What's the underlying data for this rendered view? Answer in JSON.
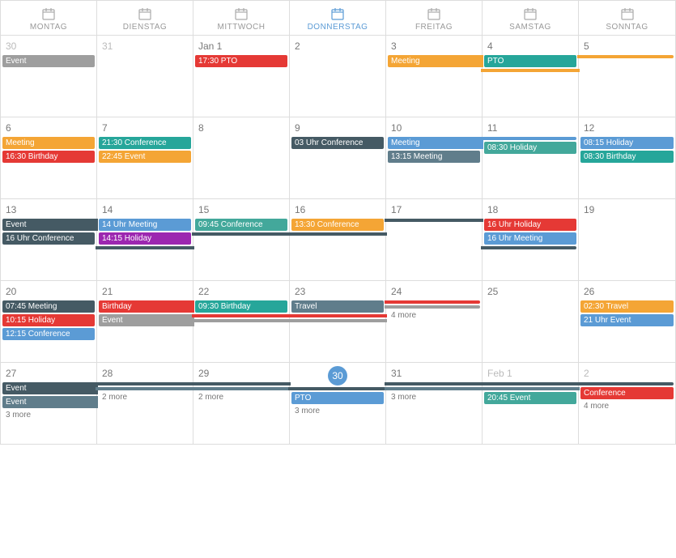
{
  "calendar": {
    "days": [
      "MONTAG",
      "DIENSTAG",
      "MITTWOCH",
      "DONNERSTAG",
      "FREITAG",
      "SAMSTAG",
      "SONNTAG"
    ],
    "today_col": 3,
    "weeks": [
      {
        "days": [
          {
            "num": "30",
            "other": true,
            "events": [
              {
                "label": "Event",
                "color": "c-gray",
                "time": "",
                "type": "normal"
              }
            ]
          },
          {
            "num": "31",
            "other": true,
            "events": []
          },
          {
            "num": "Jan 1",
            "other": false,
            "events": [
              {
                "label": "17:30 PTO",
                "color": "c-red",
                "time": "",
                "type": "normal"
              }
            ]
          },
          {
            "num": "2",
            "other": false,
            "events": []
          },
          {
            "num": "3",
            "other": false,
            "events": [
              {
                "label": "Meeting",
                "color": "c-orange",
                "time": "",
                "type": "span-start"
              }
            ]
          },
          {
            "num": "4",
            "other": false,
            "events": [
              {
                "label": "PTO",
                "color": "c-teal",
                "time": "",
                "type": "normal"
              },
              {
                "label": "",
                "color": "c-orange",
                "time": "",
                "type": "span-mid"
              }
            ]
          },
          {
            "num": "5",
            "other": false,
            "events": [
              {
                "label": "",
                "color": "c-orange",
                "time": "",
                "type": "span-end"
              }
            ]
          }
        ]
      },
      {
        "days": [
          {
            "num": "6",
            "other": false,
            "events": [
              {
                "label": "Meeting",
                "color": "c-orange",
                "time": "",
                "type": "normal"
              },
              {
                "label": "16:30 Birthday",
                "color": "c-red",
                "time": "",
                "type": "normal"
              }
            ]
          },
          {
            "num": "7",
            "other": false,
            "events": [
              {
                "label": "21:30 Conference",
                "color": "c-teal",
                "time": "",
                "type": "normal"
              },
              {
                "label": "22:45 Event",
                "color": "c-orange",
                "time": "",
                "type": "normal"
              }
            ]
          },
          {
            "num": "8",
            "other": false,
            "events": []
          },
          {
            "num": "9",
            "other": false,
            "events": [
              {
                "label": "03 Uhr Conference",
                "color": "c-darkblue",
                "time": "",
                "type": "normal"
              }
            ]
          },
          {
            "num": "10",
            "other": false,
            "events": [
              {
                "label": "Meeting",
                "color": "c-blue",
                "time": "",
                "type": "span-start"
              },
              {
                "label": "13:15 Meeting",
                "color": "c-darkgray",
                "time": "",
                "type": "normal"
              }
            ]
          },
          {
            "num": "11",
            "other": false,
            "events": [
              {
                "label": "08:30 Holiday",
                "color": "c-green",
                "time": "",
                "type": "normal"
              },
              {
                "label": "",
                "color": "c-blue",
                "time": "",
                "type": "span-end"
              }
            ]
          },
          {
            "num": "12",
            "other": false,
            "events": [
              {
                "label": "08:15 Holiday",
                "color": "c-blue",
                "time": "",
                "type": "normal"
              },
              {
                "label": "08:30 Birthday",
                "color": "c-teal",
                "time": "",
                "type": "normal"
              }
            ]
          }
        ]
      },
      {
        "days": [
          {
            "num": "13",
            "other": false,
            "events": [
              {
                "label": "Event",
                "color": "c-darkblue",
                "type": "span-start"
              },
              {
                "label": "16 Uhr Conference",
                "color": "c-darkblue",
                "time": "",
                "type": "normal"
              }
            ]
          },
          {
            "num": "14",
            "other": false,
            "events": [
              {
                "label": "14 Uhr Meeting",
                "color": "c-blue",
                "time": "",
                "type": "normal"
              },
              {
                "label": "14:15 Holiday",
                "color": "c-purple",
                "time": "",
                "type": "normal"
              },
              {
                "label": "",
                "color": "c-darkblue",
                "type": "span-mid"
              }
            ]
          },
          {
            "num": "15",
            "other": false,
            "events": [
              {
                "label": "09:45 Conference",
                "color": "c-green",
                "time": "",
                "type": "normal"
              },
              {
                "label": "",
                "color": "c-darkblue",
                "type": "span-mid"
              }
            ]
          },
          {
            "num": "16",
            "other": false,
            "events": [
              {
                "label": "13:30 Conference",
                "color": "c-orange",
                "time": "",
                "type": "normal"
              },
              {
                "label": "",
                "color": "c-darkblue",
                "type": "span-mid"
              }
            ]
          },
          {
            "num": "17",
            "other": false,
            "events": [
              {
                "label": "",
                "color": "c-darkblue",
                "type": "span-mid"
              }
            ]
          },
          {
            "num": "18",
            "other": false,
            "events": [
              {
                "label": "16 Uhr Holiday",
                "color": "c-red",
                "time": "",
                "type": "normal"
              },
              {
                "label": "16 Uhr Meeting",
                "color": "c-blue",
                "time": "",
                "type": "normal"
              },
              {
                "label": "",
                "color": "c-darkblue",
                "type": "span-end"
              }
            ]
          },
          {
            "num": "19",
            "other": false,
            "events": []
          }
        ]
      },
      {
        "days": [
          {
            "num": "20",
            "other": false,
            "events": [
              {
                "label": "07:45 Meeting",
                "color": "c-darkblue",
                "time": "",
                "type": "normal"
              },
              {
                "label": "10:15 Holiday",
                "color": "c-red",
                "time": "",
                "type": "normal"
              },
              {
                "label": "12:15 Conference",
                "color": "c-blue",
                "time": "",
                "type": "normal"
              }
            ]
          },
          {
            "num": "21",
            "other": false,
            "events": [
              {
                "label": "Birthday",
                "color": "c-red",
                "time": "",
                "type": "span-start"
              },
              {
                "label": "Event",
                "color": "c-gray",
                "time": "",
                "type": "span-start2"
              }
            ]
          },
          {
            "num": "22",
            "other": false,
            "events": [
              {
                "label": "09:30 Birthday",
                "color": "c-teal",
                "time": "",
                "type": "normal"
              },
              {
                "label": "",
                "color": "c-red",
                "type": "span-mid"
              },
              {
                "label": "",
                "color": "c-gray",
                "type": "span-mid2"
              }
            ]
          },
          {
            "num": "23",
            "other": false,
            "events": [
              {
                "label": "Travel",
                "color": "c-darkgray",
                "time": "",
                "type": "normal"
              },
              {
                "label": "",
                "color": "c-red",
                "type": "span-mid"
              },
              {
                "label": "",
                "color": "c-gray",
                "type": "span-mid2"
              }
            ]
          },
          {
            "num": "24",
            "other": false,
            "events": [
              {
                "label": "4 more",
                "color": "",
                "time": "",
                "type": "more"
              },
              {
                "label": "",
                "color": "c-red",
                "type": "span-end"
              },
              {
                "label": "",
                "color": "c-gray",
                "type": "span-end2"
              }
            ]
          },
          {
            "num": "25",
            "other": false,
            "events": []
          },
          {
            "num": "26",
            "other": false,
            "events": [
              {
                "label": "02:30 Travel",
                "color": "c-orange",
                "time": "",
                "type": "normal"
              },
              {
                "label": "21 Uhr Event",
                "color": "c-blue",
                "time": "",
                "type": "normal"
              }
            ]
          }
        ]
      },
      {
        "days": [
          {
            "num": "27",
            "other": false,
            "events": [
              {
                "label": "Event",
                "color": "c-darkblue",
                "type": "span-start"
              },
              {
                "label": "Event",
                "color": "c-darkgray",
                "type": "span-start2"
              }
            ]
          },
          {
            "num": "28",
            "other": false,
            "events": [
              {
                "label": "",
                "color": "c-darkblue",
                "type": "span-mid"
              },
              {
                "label": "",
                "color": "c-darkgray",
                "type": "span-mid2"
              },
              {
                "label": "2 more",
                "color": "",
                "type": "more"
              }
            ]
          },
          {
            "num": "29",
            "other": false,
            "events": [
              {
                "label": "",
                "color": "c-darkblue",
                "type": "span-mid"
              },
              {
                "label": "",
                "color": "c-darkgray",
                "type": "span-mid2"
              },
              {
                "label": "2 more",
                "color": "",
                "type": "more"
              }
            ]
          },
          {
            "num": "30",
            "other": false,
            "today": true,
            "events": [
              {
                "label": "",
                "color": "c-darkblue",
                "type": "span-mid"
              },
              {
                "label": "PTO",
                "color": "c-blue",
                "type": "normal"
              },
              {
                "label": "3 more",
                "color": "",
                "type": "more"
              }
            ]
          },
          {
            "num": "31",
            "other": false,
            "events": [
              {
                "label": "",
                "color": "c-darkblue",
                "type": "span-end"
              },
              {
                "label": "",
                "color": "c-darkgray",
                "type": "span-end2"
              },
              {
                "label": "3 more",
                "color": "",
                "type": "more"
              }
            ]
          },
          {
            "num": "Feb 1",
            "other": false,
            "events": [
              {
                "label": "20:45 Event",
                "color": "c-green",
                "type": "normal"
              }
            ]
          },
          {
            "num": "2",
            "other": false,
            "events": [
              {
                "label": "Conference",
                "color": "c-red",
                "type": "normal"
              },
              {
                "label": "4 more",
                "color": "",
                "type": "more"
              }
            ]
          }
        ]
      }
    ],
    "mores": [
      {
        "col": 1,
        "label": "3 more"
      },
      {
        "col": 2,
        "label": "2 more"
      },
      {
        "col": 3,
        "label": "2 more"
      },
      {
        "col": 4,
        "label": "3 more"
      },
      {
        "col": 5,
        "label": "3 more"
      },
      {
        "col": 7,
        "label": "4 more"
      }
    ]
  }
}
